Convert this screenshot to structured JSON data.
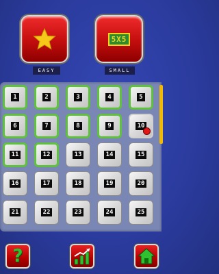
{
  "top": {
    "difficulty_label": "EASY",
    "size_label": "SMALL",
    "size_value": "5X5",
    "difficulty_icon": "star-icon"
  },
  "levels": [
    {
      "n": "1",
      "state": "done"
    },
    {
      "n": "2",
      "state": "done"
    },
    {
      "n": "3",
      "state": "done"
    },
    {
      "n": "4",
      "state": "done"
    },
    {
      "n": "5",
      "state": "done"
    },
    {
      "n": "6",
      "state": "done"
    },
    {
      "n": "7",
      "state": "done"
    },
    {
      "n": "8",
      "state": "done"
    },
    {
      "n": "9",
      "state": "done"
    },
    {
      "n": "10",
      "state": "current"
    },
    {
      "n": "11",
      "state": "done"
    },
    {
      "n": "12",
      "state": "done"
    },
    {
      "n": "13",
      "state": "locked"
    },
    {
      "n": "14",
      "state": "locked"
    },
    {
      "n": "15",
      "state": "locked"
    },
    {
      "n": "16",
      "state": "locked"
    },
    {
      "n": "17",
      "state": "locked"
    },
    {
      "n": "18",
      "state": "locked"
    },
    {
      "n": "19",
      "state": "locked"
    },
    {
      "n": "20",
      "state": "locked"
    },
    {
      "n": "21",
      "state": "locked"
    },
    {
      "n": "22",
      "state": "locked"
    },
    {
      "n": "23",
      "state": "locked"
    },
    {
      "n": "24",
      "state": "locked"
    },
    {
      "n": "25",
      "state": "locked"
    }
  ],
  "bottom": {
    "help_icon": "question-icon",
    "stats_icon": "chart-icon",
    "home_icon": "home-icon"
  },
  "colors": {
    "background": "#2a3a9c",
    "button_red": "#c30d0d",
    "done_border": "#5fc23c",
    "star": "#f6c81a",
    "scrollbar": "#f4b800"
  }
}
